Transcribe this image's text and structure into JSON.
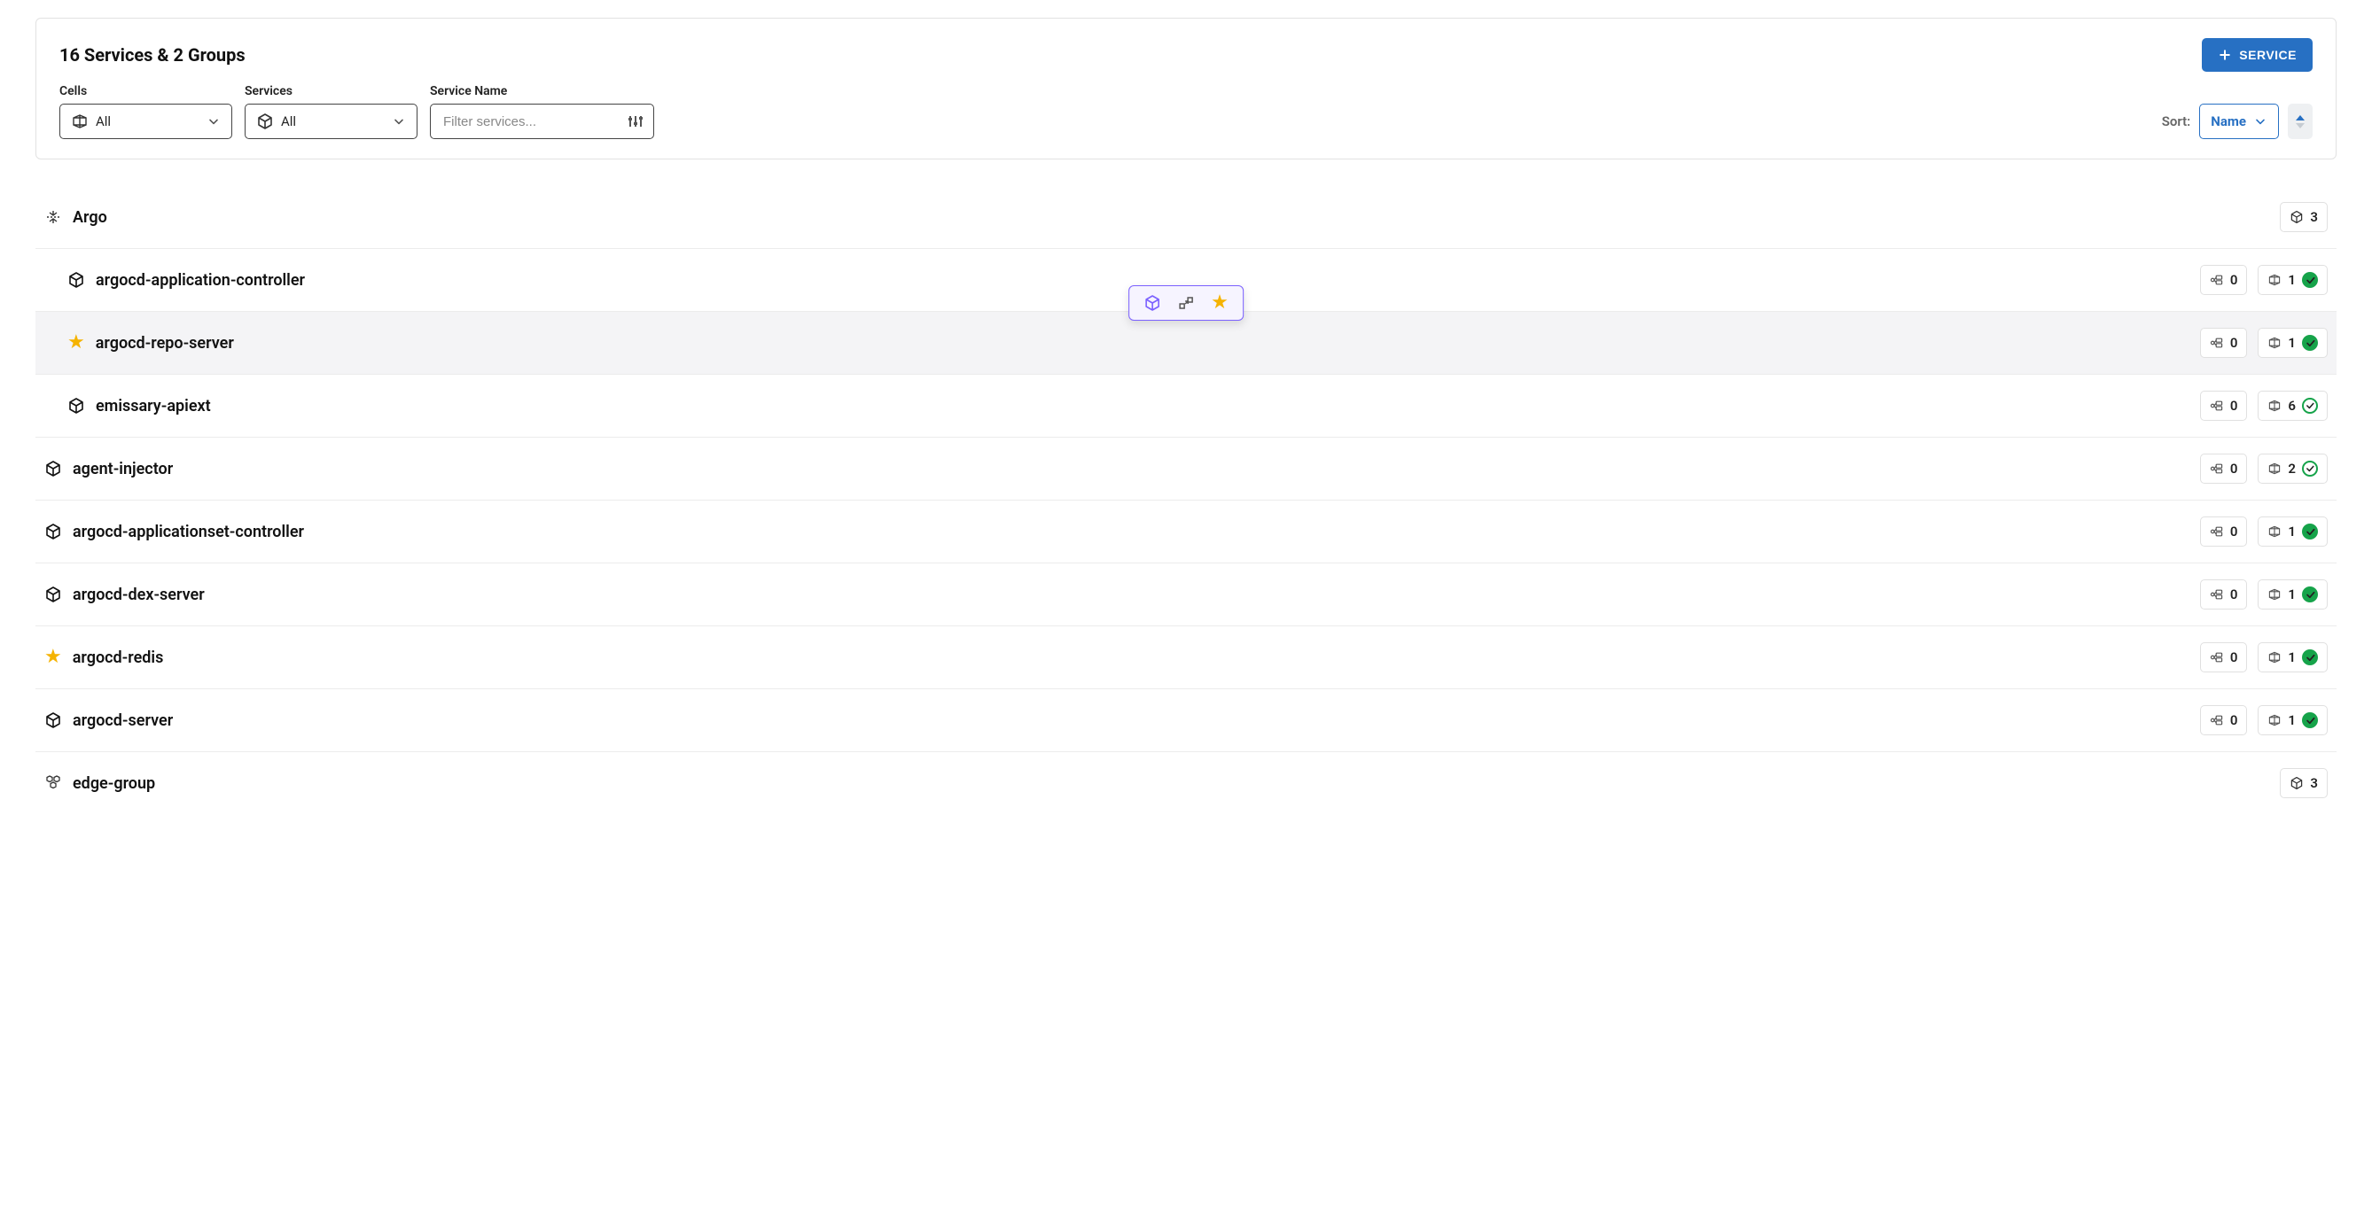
{
  "header": {
    "title": "16 Services & 2 Groups",
    "add_button": "SERVICE"
  },
  "filters": {
    "cells_label": "Cells",
    "cells_value": "All",
    "services_label": "Services",
    "services_value": "All",
    "name_label": "Service Name",
    "name_placeholder": "Filter services..."
  },
  "sort": {
    "label": "Sort:",
    "value": "Name"
  },
  "groups": [
    {
      "name": "Argo",
      "count": "3",
      "services": [
        {
          "name": "argocd-application-controller",
          "favorite": false,
          "stat_a": "0",
          "stat_b": "1",
          "check_style": "filled",
          "highlighted": false
        },
        {
          "name": "argocd-repo-server",
          "favorite": true,
          "stat_a": "0",
          "stat_b": "1",
          "check_style": "filled",
          "highlighted": true
        },
        {
          "name": "emissary-apiext",
          "favorite": false,
          "stat_a": "0",
          "stat_b": "6",
          "check_style": "outline",
          "highlighted": false
        }
      ]
    }
  ],
  "services": [
    {
      "name": "agent-injector",
      "favorite": false,
      "stat_a": "0",
      "stat_b": "2",
      "check_style": "outline"
    },
    {
      "name": "argocd-applicationset-controller",
      "favorite": false,
      "stat_a": "0",
      "stat_b": "1",
      "check_style": "filled"
    },
    {
      "name": "argocd-dex-server",
      "favorite": false,
      "stat_a": "0",
      "stat_b": "1",
      "check_style": "filled"
    },
    {
      "name": "argocd-redis",
      "favorite": true,
      "stat_a": "0",
      "stat_b": "1",
      "check_style": "filled"
    },
    {
      "name": "argocd-server",
      "favorite": false,
      "stat_a": "0",
      "stat_b": "1",
      "check_style": "filled"
    }
  ],
  "trailing_group": {
    "name": "edge-group",
    "count": "3"
  }
}
